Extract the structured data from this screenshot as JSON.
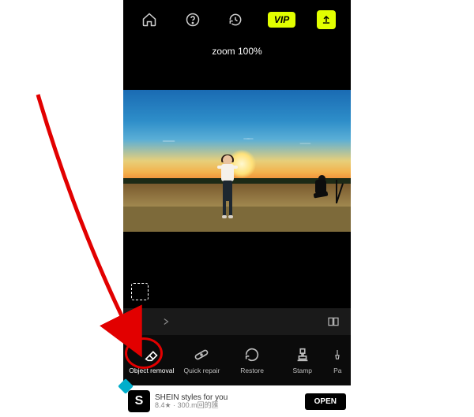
{
  "topbar": {
    "vip_label": "VIP"
  },
  "zoom": {
    "text": "zoom 100%"
  },
  "toolbar": {
    "items": [
      {
        "label": "Object removal"
      },
      {
        "label": "Quick repair"
      },
      {
        "label": "Restore"
      },
      {
        "label": "Stamp"
      },
      {
        "label": "Pa"
      }
    ]
  },
  "ad": {
    "logo_letter": "S",
    "line1": "SHEIN styles for you",
    "line2": "8.4★ · 300.m回的匯",
    "open_label": "OPEN"
  },
  "colors": {
    "accent": "#e2ff00",
    "annotation": "#e20000"
  }
}
